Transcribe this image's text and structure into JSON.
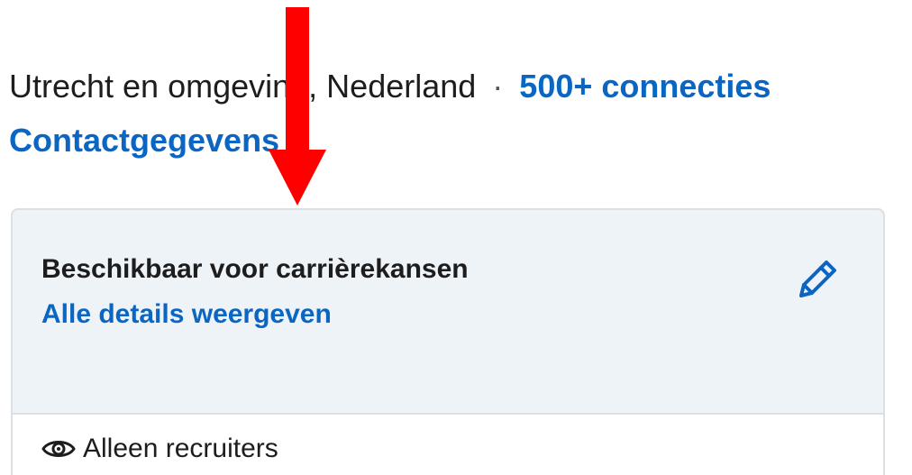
{
  "profile": {
    "location": "Utrecht en omgeving, Nederland",
    "separator": "·",
    "connections": "500+ connecties",
    "contact_info": "Contactgegevens"
  },
  "open_to_work_card": {
    "title": "Beschikbaar voor carrièrekansen",
    "details_link": "Alle details weergeven",
    "visibility_label": "Alleen recruiters",
    "edit_icon": "pencil-icon",
    "visibility_icon": "eye-icon"
  },
  "annotation": {
    "arrow_color": "#ff0000",
    "arrow_direction": "down"
  },
  "colors": {
    "link": "#0a66c2",
    "card_background": "#eef3f8",
    "text": "#1d1d1d"
  }
}
